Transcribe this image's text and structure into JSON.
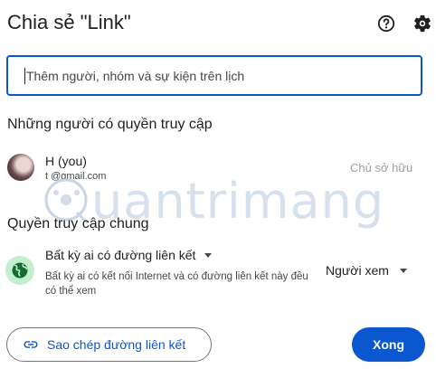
{
  "dialog": {
    "title": "Chia sẻ \"Link\""
  },
  "search": {
    "placeholder": "Thêm người, nhóm và sự kiện trên lịch"
  },
  "people_section": {
    "title": "Những người có quyền truy cập",
    "person": {
      "name": "H              (you)",
      "email": "t              @gmail.com",
      "role": "Chủ sở hữu"
    }
  },
  "general_access": {
    "title": "Quyền truy cập chung",
    "selected": "Bất kỳ ai có đường liên kết",
    "description": "Bất kỳ ai có kết nối Internet và có đường liên kết này đều có thể xem",
    "role": "Người xem"
  },
  "footer": {
    "copy_link_label": "Sao chép đường liên kết",
    "done_label": "Xong"
  },
  "colors": {
    "accent": "#0b57d0",
    "globe_bg": "#c4eed0",
    "globe_fg": "#146c2e"
  },
  "icons": [
    "help-icon",
    "settings-gear-icon",
    "globe-icon",
    "dropdown-arrow-icon",
    "link-icon"
  ],
  "watermark": "Quantrimang"
}
